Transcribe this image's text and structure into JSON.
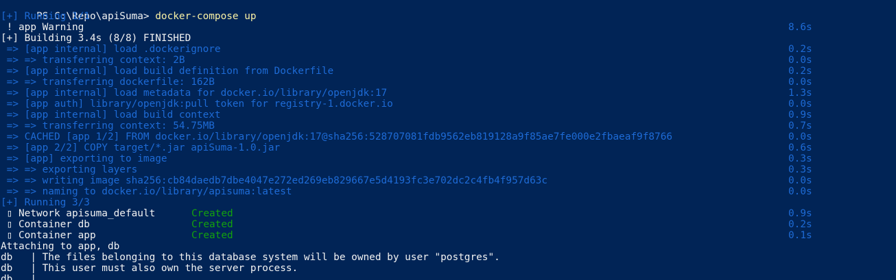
{
  "terminal": {
    "colors": {
      "background": "#012456",
      "text": "#f2f2f2",
      "blue": "#1e6bd6",
      "yellow": "#f9f1a5",
      "green": "#13a10e"
    },
    "lines": [
      {
        "prompt": "PS C:\\Repo\\apiSuma> ",
        "command": "docker-compose up"
      },
      {
        "text": "[+] Running 1/1",
        "time": ""
      },
      {
        "text": " ! app Warning",
        "time": "8.6s"
      },
      {
        "text": "[+] Building 3.4s (8/8) FINISHED",
        "time": ""
      },
      {
        "text": " => [app internal] load .dockerignore",
        "time": "0.2s"
      },
      {
        "text": " => => transferring context: 2B",
        "time": "0.0s"
      },
      {
        "text": " => [app internal] load build definition from Dockerfile",
        "time": "0.2s"
      },
      {
        "text": " => => transferring dockerfile: 162B",
        "time": "0.0s"
      },
      {
        "text": " => [app internal] load metadata for docker.io/library/openjdk:17",
        "time": "1.3s"
      },
      {
        "text": " => [app auth] library/openjdk:pull token for registry-1.docker.io",
        "time": "0.0s"
      },
      {
        "text": " => [app internal] load build context",
        "time": "0.9s"
      },
      {
        "text": " => => transferring context: 54.75MB",
        "time": "0.7s"
      },
      {
        "text": " => CACHED [app 1/2] FROM docker.io/library/openjdk:17@sha256:528707081fdb9562eb819128a9f85ae7fe000e2fbaeaf9f8766",
        "time": "0.0s"
      },
      {
        "text": " => [app 2/2] COPY target/*.jar apiSuma-1.0.jar",
        "time": "0.6s"
      },
      {
        "text": " => [app] exporting to image",
        "time": "0.3s"
      },
      {
        "text": " => => exporting layers",
        "time": "0.3s"
      },
      {
        "text": " => => writing image sha256:cb84daedb7dbe4047e272ed269eb829667e5d4193fc3e702dc2c4fb4f957d63c",
        "time": "0.0s"
      },
      {
        "text": " => => naming to docker.io/library/apisuma:latest",
        "time": "0.0s"
      },
      {
        "text": "[+] Running 3/3",
        "time": ""
      },
      {
        "text": " ▯ Network apisuma_default",
        "status": "Created",
        "time": "0.9s"
      },
      {
        "text": " ▯ Container db",
        "status": "Created",
        "time": "0.2s"
      },
      {
        "text": " ▯ Container app",
        "status": "Created",
        "time": "0.1s"
      },
      {
        "text": "Attaching to app, db",
        "time": ""
      },
      {
        "text": "db   | The files belonging to this database system will be owned by user \"postgres\".",
        "time": ""
      },
      {
        "text": "db   | This user must also own the server process.",
        "time": ""
      },
      {
        "text": "db   |",
        "time": ""
      }
    ]
  }
}
